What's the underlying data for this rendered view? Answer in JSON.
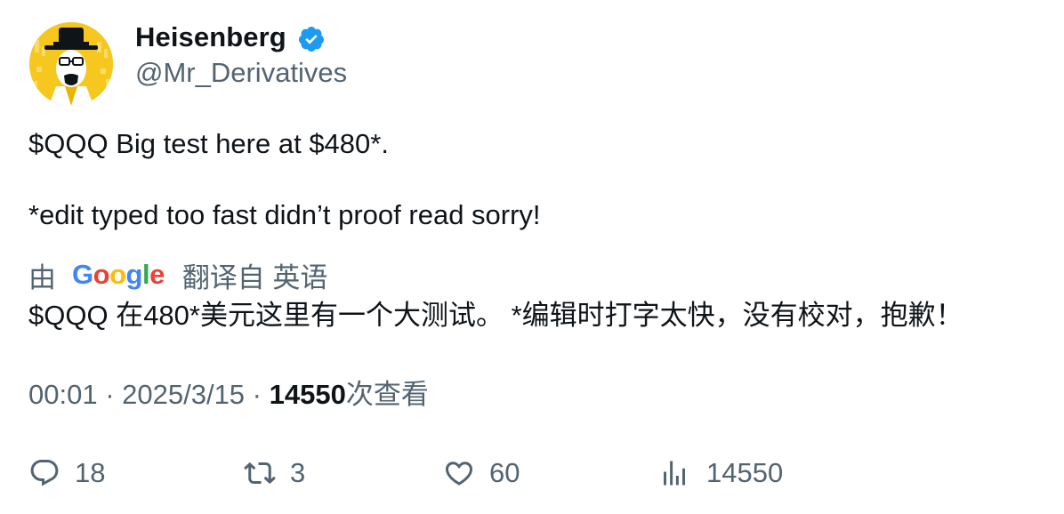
{
  "author": {
    "display_name": "Heisenberg",
    "handle": "@Mr_Derivatives",
    "avatar_icon": "avatar-icon",
    "verified_icon": "verified-badge-icon",
    "verified_color": "#1d9bf0"
  },
  "tweet": {
    "line1": "$QQQ Big test here at $480*.",
    "line2": "*edit typed too fast didn’t proof read sorry!"
  },
  "translation": {
    "by_label": "由",
    "provider_letters": [
      "G",
      "o",
      "o",
      "g",
      "l",
      "e"
    ],
    "from_label": "翻译自 英语",
    "text": "$QQQ 在480*美元这里有一个大测试。 *编辑时打字太快，没有校对，抱歉！"
  },
  "meta": {
    "time": "00:01",
    "separator": " · ",
    "date": "2025/3/15",
    "views_count": "14550",
    "views_label": "次查看"
  },
  "actions": {
    "reply_count": "18",
    "retweet_count": "3",
    "like_count": "60",
    "views_count": "14550",
    "icons": [
      "reply-icon",
      "retweet-icon",
      "like-icon",
      "views-icon"
    ],
    "icon_color": "#536471"
  }
}
